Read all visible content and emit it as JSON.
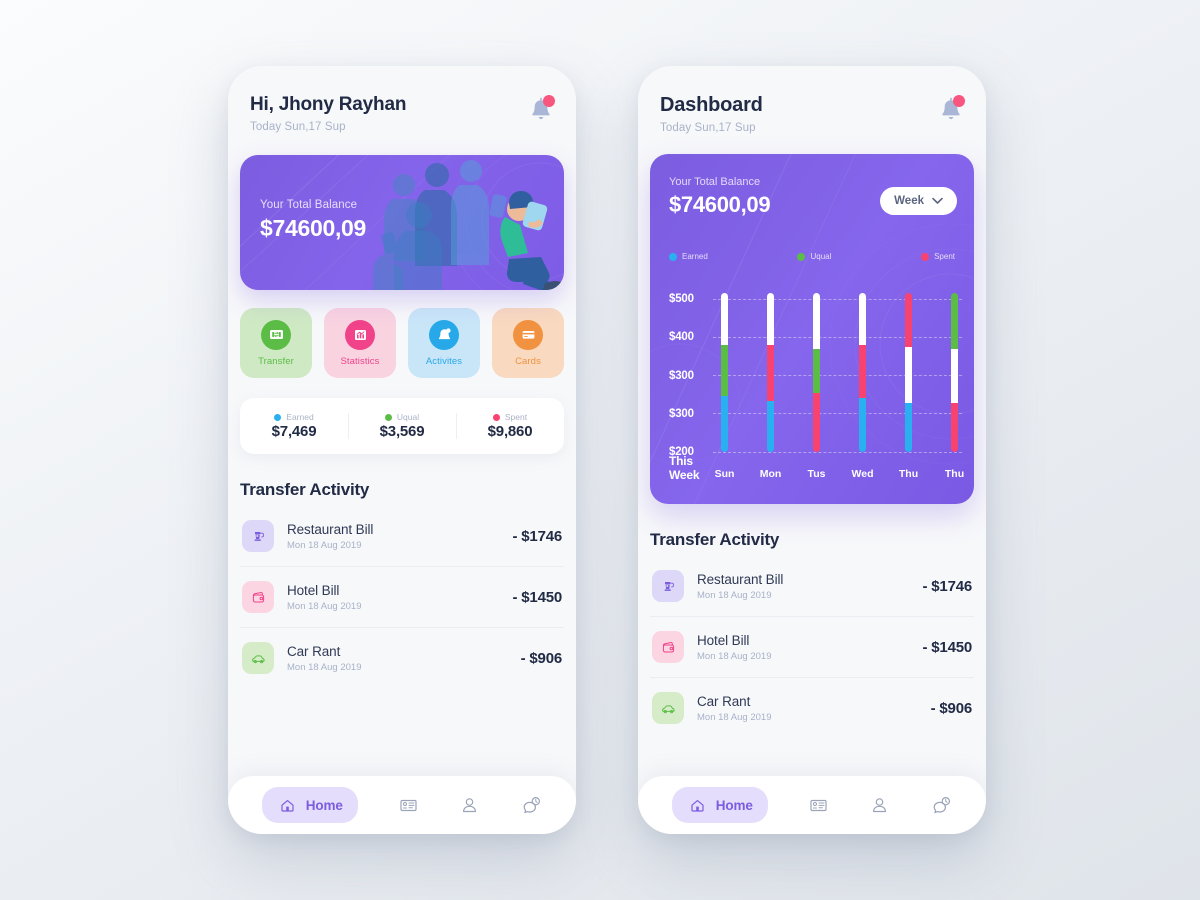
{
  "left_phone": {
    "header": {
      "title": "Hi, Jhony Rayhan",
      "subtitle": "Today Sun,17 Sup",
      "bell_icon": "bell-icon"
    },
    "balance_card": {
      "label": "Your Total Balance",
      "amount": "$74600,09"
    },
    "actions": [
      {
        "label": "Transfer",
        "icon": "transfer-icon",
        "tile_bg": "#cfe9c4",
        "circle": "#5cbd46",
        "text": "#5cbd46"
      },
      {
        "label": "Statistics",
        "icon": "statistics-icon",
        "tile_bg": "#f9d3e0",
        "circle": "#f0438a",
        "text": "#f0438a"
      },
      {
        "label": "Activites",
        "icon": "activities-icon",
        "tile_bg": "#c9e6f8",
        "circle": "#27a8e8",
        "text": "#27a8e8"
      },
      {
        "label": "Cards",
        "icon": "cards-icon",
        "tile_bg": "#f9d9bf",
        "circle": "#f0923f",
        "text": "#f0923f"
      }
    ],
    "stats": [
      {
        "label": "Earned",
        "value": "$7,469",
        "color": "#29b0f0"
      },
      {
        "label": "Uqual",
        "value": "$3,569",
        "color": "#4cc railing"
      },
      {
        "label": "Spent",
        "value": "$9,860",
        "color": "#f8426f"
      }
    ],
    "section_title": "Transfer Activity",
    "transactions": [
      {
        "name": "Restaurant Bill",
        "date": "Mon 18 Aug 2019",
        "amount": "- $1746",
        "icon": "coffee-machine-icon",
        "bg": "#ddd8f7",
        "fg": "#7c5de0"
      },
      {
        "name": "Hotel Bill",
        "date": "Mon 18 Aug 2019",
        "amount": "- $1450",
        "icon": "wallet-icon",
        "bg": "#fbd6e2",
        "fg": "#f0438a"
      },
      {
        "name": "Car Rant",
        "date": "Mon 18 Aug 2019",
        "amount": "- $906",
        "icon": "car-icon",
        "bg": "#d6ecc8",
        "fg": "#5cbd46"
      }
    ],
    "nav": [
      {
        "label": "Home",
        "icon": "home-icon",
        "active": true
      },
      {
        "label": "",
        "icon": "card-icon",
        "active": false
      },
      {
        "label": "",
        "icon": "person-icon",
        "active": false
      },
      {
        "label": "",
        "icon": "history-chat-icon",
        "active": false
      }
    ]
  },
  "right_phone": {
    "header": {
      "title": "Dashboard",
      "subtitle": "Today Sun,17 Sup",
      "bell_icon": "bell-icon"
    },
    "chart_card": {
      "label": "Your Total Balance",
      "amount": "$74600,09",
      "period_selector": {
        "label": "Week",
        "icon": "chevron-down-icon"
      }
    },
    "section_title": "Transfer Activity",
    "transactions": [
      {
        "name": "Restaurant Bill",
        "date": "Mon 18 Aug 2019",
        "amount": "- $1746",
        "icon": "coffee-machine-icon",
        "bg": "#ddd8f7",
        "fg": "#7c5de0"
      },
      {
        "name": "Hotel Bill",
        "date": "Mon 18 Aug 2019",
        "amount": "- $1450",
        "icon": "wallet-icon",
        "bg": "#fbd6e2",
        "fg": "#f0438a"
      },
      {
        "name": "Car Rant",
        "date": "Mon 18 Aug 2019",
        "amount": "- $906",
        "icon": "car-icon",
        "bg": "#d6ecc8",
        "fg": "#5cbd46"
      }
    ],
    "nav": [
      {
        "label": "Home",
        "icon": "home-icon",
        "active": true
      },
      {
        "label": "",
        "icon": "card-icon",
        "active": false
      },
      {
        "label": "",
        "icon": "person-icon",
        "active": false
      },
      {
        "label": "",
        "icon": "history-chat-icon",
        "active": false
      }
    ]
  },
  "chart_data": {
    "type": "bar",
    "title": "Your Total Balance",
    "subtitle": "$74600,09",
    "xlabel": "This Week",
    "ylabel": "",
    "stacked": true,
    "grid": true,
    "legend_position": "top",
    "axis_row_label": "This Week",
    "ytick_labels": [
      "$500",
      "$400",
      "$300",
      "$300",
      "$200"
    ],
    "categories": [
      "Sun",
      "Mon",
      "Tus",
      "Wed",
      "Thu",
      "Thu"
    ],
    "legend": [
      {
        "name": "Earned",
        "color": "#29b0f0"
      },
      {
        "name": "Uqual",
        "color": "#5cbd46"
      },
      {
        "name": "Spent",
        "color": "#f8426f"
      }
    ],
    "colors": {
      "earned": "#29b0f0",
      "uqual": "#5cbd46",
      "spent": "#f8426f",
      "empty": "#ffffff"
    },
    "bars": [
      {
        "category": "Sun",
        "top_pct": 100,
        "segments": [
          {
            "series": "empty",
            "pct": 33
          },
          {
            "series": "uqual",
            "pct": 32
          },
          {
            "series": "earned",
            "pct": 35
          }
        ]
      },
      {
        "category": "Mon",
        "top_pct": 100,
        "segments": [
          {
            "series": "empty",
            "pct": 33
          },
          {
            "series": "spent",
            "pct": 35
          },
          {
            "series": "earned",
            "pct": 32
          }
        ]
      },
      {
        "category": "Tus",
        "top_pct": 100,
        "segments": [
          {
            "series": "empty",
            "pct": 35
          },
          {
            "series": "uqual",
            "pct": 28
          },
          {
            "series": "spent",
            "pct": 37
          }
        ]
      },
      {
        "category": "Wed",
        "top_pct": 100,
        "segments": [
          {
            "series": "empty",
            "pct": 33
          },
          {
            "series": "spent",
            "pct": 33
          },
          {
            "series": "earned",
            "pct": 34
          }
        ]
      },
      {
        "category": "Thu",
        "top_pct": 100,
        "segments": [
          {
            "series": "spent",
            "pct": 34
          },
          {
            "series": "empty",
            "pct": 35
          },
          {
            "series": "earned",
            "pct": 31
          }
        ]
      },
      {
        "category": "Thu",
        "top_pct": 100,
        "segments": [
          {
            "series": "uqual",
            "pct": 35
          },
          {
            "series": "empty",
            "pct": 34
          },
          {
            "series": "spent",
            "pct": 31
          }
        ]
      }
    ]
  }
}
